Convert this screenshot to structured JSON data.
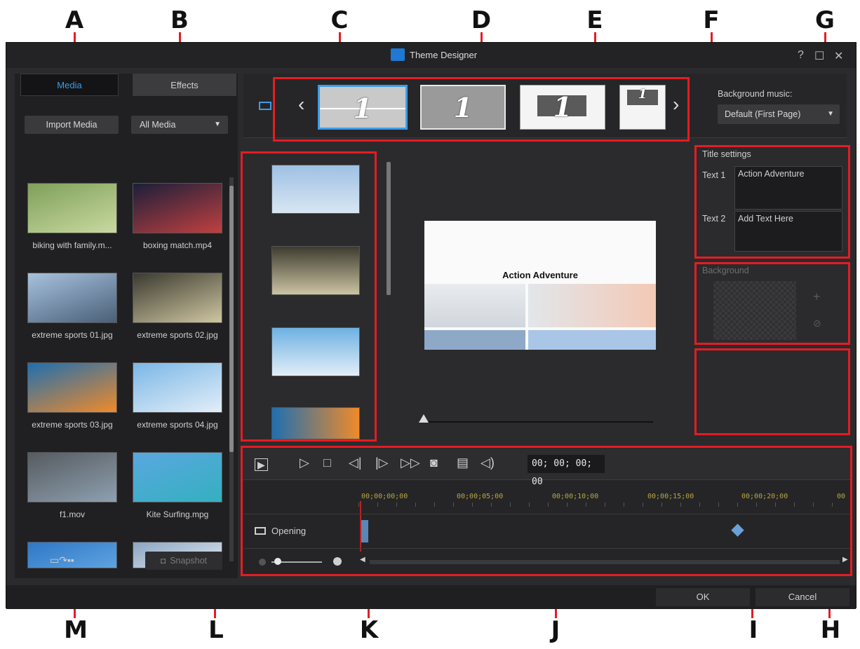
{
  "callouts": {
    "a": "A",
    "b": "B",
    "c": "C",
    "d": "D",
    "e": "E",
    "f": "F",
    "g": "G",
    "h": "H",
    "i": "I",
    "j": "J",
    "k": "K",
    "l": "L",
    "m": "M"
  },
  "window": {
    "title": "Theme Designer",
    "controls": {
      "help": "?",
      "maximize": "☐",
      "close": "✕"
    }
  },
  "left_panel": {
    "tabs": [
      "Media",
      "Effects"
    ],
    "import_button": "Import Media",
    "filter_select": "All Media",
    "items": [
      {
        "label": "biking with family.m...",
        "colors": [
          "#7fa05a",
          "#c9d9a0"
        ]
      },
      {
        "label": "boxing match.mp4",
        "colors": [
          "#1b1f3a",
          "#c04040"
        ]
      },
      {
        "label": "extreme sports 01.jpg",
        "colors": [
          "#a7c2de",
          "#4a5f78"
        ]
      },
      {
        "label": "extreme sports 02.jpg",
        "colors": [
          "#3b3a30",
          "#cfc6a0"
        ]
      },
      {
        "label": "extreme sports 03.jpg",
        "colors": [
          "#1f6fb0",
          "#f08a2a"
        ]
      },
      {
        "label": "extreme sports 04.jpg",
        "colors": [
          "#7bb7e6",
          "#e2eef8"
        ]
      },
      {
        "label": "f1.mov",
        "colors": [
          "#565b60",
          "#8ea0b0"
        ]
      },
      {
        "label": "Kite Surfing.mpg",
        "colors": [
          "#5aa7df",
          "#34b0c0"
        ]
      },
      {
        "label": "",
        "colors": [
          "#2f77c6",
          "#5ea3e0"
        ]
      },
      {
        "label": "",
        "colors": [
          "#8ca6c2",
          "#dfe6ee"
        ]
      }
    ],
    "snapshot_button": "Snapshot"
  },
  "template_strip": {
    "prev": "‹",
    "next": "›",
    "templates": [
      {
        "num": "1",
        "selected": true
      },
      {
        "num": "1",
        "selected": false
      },
      {
        "num": "1",
        "selected": false
      },
      {
        "num": "1",
        "selected": false
      }
    ]
  },
  "right_panel": {
    "bg_music_label": "Background music:",
    "bg_music_value": "Default (First Page)",
    "title_settings_label": "Title settings",
    "text1_label": "Text 1",
    "text1_value": "Action Adventure",
    "text2_label": "Text 2",
    "text2_value": "Add Text Here",
    "background_label": "Background"
  },
  "preview": {
    "title": "Action Adventure"
  },
  "timeline": {
    "timecode": "00; 00; 00; 00",
    "ruler": [
      "00;00;00;00",
      "00;00;05;00",
      "00;00;10;00",
      "00;00;15;00",
      "00;00;20;00",
      "00"
    ],
    "track_label": "Opening"
  },
  "footer": {
    "ok": "OK",
    "cancel": "Cancel"
  },
  "colors": {
    "callout_red": "#e51c23",
    "accent_blue": "#3b9de8"
  }
}
